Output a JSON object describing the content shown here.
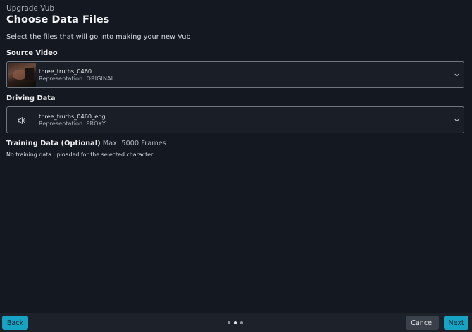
{
  "header": {
    "kicker": "Upgrade Vub",
    "title": "Choose Data Files",
    "subtitle": "Select the files that will go into making your new Vub"
  },
  "source_video": {
    "label": "Source Video",
    "selected": {
      "name": "three_truths_0460",
      "representation": "Representation: ORIGINAL"
    }
  },
  "driving_data": {
    "label": "Driving Data",
    "selected": {
      "name": "three_truths_0460_eng",
      "representation": "Representation: PROXY"
    }
  },
  "training_data": {
    "label": "Training Data (Optional)",
    "note": "Max. 5000 Frames",
    "empty_message": "No training data uploaded for the selected character."
  },
  "footer": {
    "back_label": "Back",
    "cancel_label": "Cancel",
    "next_label": "Next",
    "step_count": 3,
    "current_step": 2
  },
  "colors": {
    "accent": "#16a3c4",
    "background": "#141820",
    "footer_background": "#1c212a",
    "secondary_button": "#3a414b"
  },
  "icons": {
    "audio": "speaker-icon",
    "dropdown": "chevron-down-icon"
  }
}
